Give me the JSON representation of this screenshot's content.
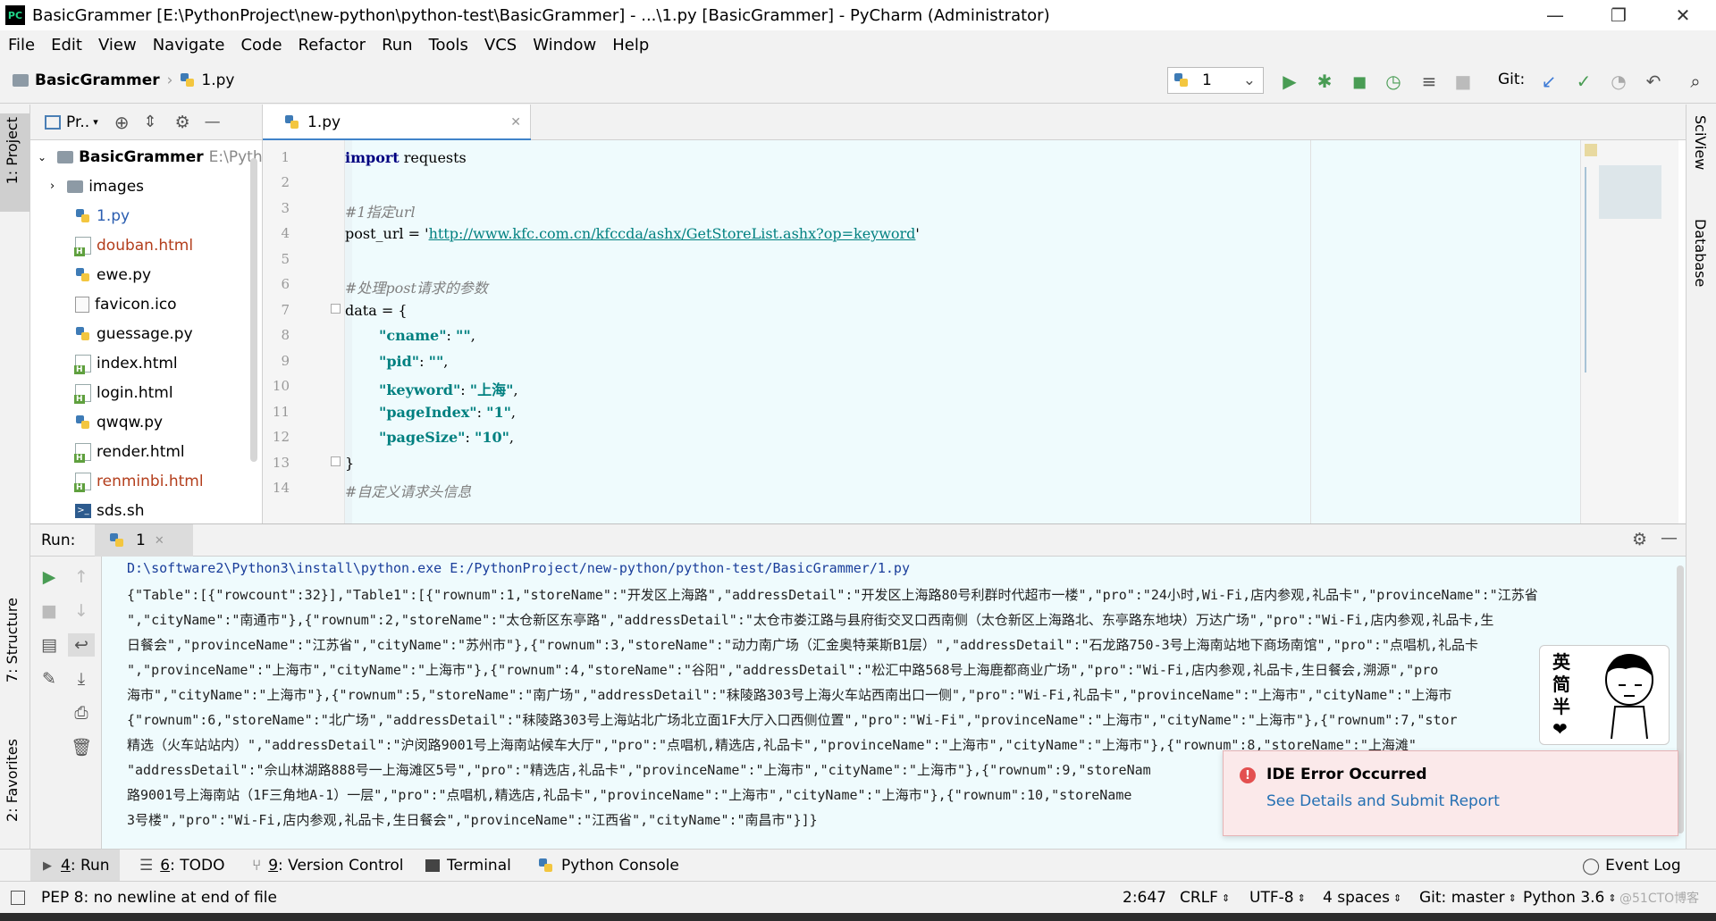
{
  "window": {
    "title": "BasicGrammer [E:\\PythonProject\\new-python\\python-test\\BasicGrammer] - ...\\1.py [BasicGrammer] - PyCharm (Administrator)",
    "app_icon": "PC"
  },
  "menu": [
    "File",
    "Edit",
    "View",
    "Navigate",
    "Code",
    "Refactor",
    "Run",
    "Tools",
    "VCS",
    "Window",
    "Help"
  ],
  "navbar": {
    "project": "BasicGrammer",
    "file": "1.py",
    "run_config": "1",
    "git_label": "Git:"
  },
  "left_stripe": {
    "project_tab": "1: Project",
    "structure_tab": "7: Structure",
    "favorites_tab": "2: Favorites"
  },
  "right_stripe": {
    "sciview_tab": "SciView",
    "database_tab": "Database"
  },
  "project_panel": {
    "header": "Pr..",
    "root": {
      "name": "BasicGrammer",
      "path": "E:\\Pytho"
    },
    "items": [
      {
        "name": "images",
        "type": "folder"
      },
      {
        "name": "1.py",
        "type": "py",
        "color": "#2a5db0"
      },
      {
        "name": "douban.html",
        "type": "html",
        "color": "#b33e1c"
      },
      {
        "name": "ewe.py",
        "type": "py",
        "color": "#000000"
      },
      {
        "name": "favicon.ico",
        "type": "file",
        "color": "#000000"
      },
      {
        "name": "guessage.py",
        "type": "py",
        "color": "#000000"
      },
      {
        "name": "index.html",
        "type": "html",
        "color": "#000000"
      },
      {
        "name": "login.html",
        "type": "html",
        "color": "#000000"
      },
      {
        "name": "qwqw.py",
        "type": "py",
        "color": "#000000"
      },
      {
        "name": "render.html",
        "type": "html",
        "color": "#000000"
      },
      {
        "name": "renminbi.html",
        "type": "html",
        "color": "#b33e1c"
      },
      {
        "name": "sds.sh",
        "type": "sh",
        "color": "#000000"
      }
    ]
  },
  "editor": {
    "tab_label": "1.py",
    "line_numbers": [
      "1",
      "2",
      "3",
      "4",
      "5",
      "6",
      "7",
      "8",
      "9",
      "10",
      "11",
      "12",
      "13",
      "14"
    ],
    "lines": {
      "l1_kw": "import",
      "l1_rest": " requests",
      "l3": "#1指定url",
      "l4_a": "post_url = '",
      "l4_url": "http://www.kfc.com.cn/kfccda/ashx/GetStoreList.ashx?op=keyword",
      "l4_b": "'",
      "l6": "#处理post请求的参数",
      "l7": "data = {",
      "l8_k": "\"cname\"",
      "l8_v": "\"\"",
      "l9_k": "\"pid\"",
      "l9_v": "\"\"",
      "l10_k": "\"keyword\"",
      "l10_v": "\"上海\"",
      "l11_k": "\"pageIndex\"",
      "l11_v": "\"1\"",
      "l12_k": "\"pageSize\"",
      "l12_v": "\"10\"",
      "l13": "}",
      "l14": "#自定义请求头信息"
    }
  },
  "run_panel": {
    "label": "Run:",
    "tab": "1",
    "command": "D:\\software2\\Python3\\install\\python.exe E:/PythonProject/new-python/python-test/BasicGrammer/1.py",
    "output": [
      "{\"Table\":[{\"rowcount\":32}],\"Table1\":[{\"rownum\":1,\"storeName\":\"开发区上海路\",\"addressDetail\":\"开发区上海路80号利群时代超市一楼\",\"pro\":\"24小时,Wi-Fi,店内参观,礼品卡\",\"provinceName\":\"江苏省",
      "\",\"cityName\":\"南通市\"},{\"rownum\":2,\"storeName\":\"太仓新区东亭路\",\"addressDetail\":\"太仓市娄江路与县府街交叉口西南侧（太仓新区上海路北、东亭路东地块）万达广场\",\"pro\":\"Wi-Fi,店内参观,礼品卡,生",
      "日餐会\",\"provinceName\":\"江苏省\",\"cityName\":\"苏州市\"},{\"rownum\":3,\"storeName\":\"动力南广场（汇金奥特莱斯B1层）\",\"addressDetail\":\"石龙路750-3号上海南站地下商场南馆\",\"pro\":\"点唱机,礼品卡",
      "\",\"provinceName\":\"上海市\",\"cityName\":\"上海市\"},{\"rownum\":4,\"storeName\":\"谷阳\",\"addressDetail\":\"松汇中路568号上海鹿都商业广场\",\"pro\":\"Wi-Fi,店内参观,礼品卡,生日餐会,溯源\",\"pro",
      "海市\",\"cityName\":\"上海市\"},{\"rownum\":5,\"storeName\":\"南广场\",\"addressDetail\":\"秣陵路303号上海火车站西南出口一侧\",\"pro\":\"Wi-Fi,礼品卡\",\"provinceName\":\"上海市\",\"cityName\":\"上海市",
      "{\"rownum\":6,\"storeName\":\"北广场\",\"addressDetail\":\"秣陵路303号上海站北广场北立面1F大厅入口西侧位置\",\"pro\":\"Wi-Fi\",\"provinceName\":\"上海市\",\"cityName\":\"上海市\"},{\"rownum\":7,\"stor",
      "精选（火车站站内）\",\"addressDetail\":\"沪闵路9001号上海南站候车大厅\",\"pro\":\"点唱机,精选店,礼品卡\",\"provinceName\":\"上海市\",\"cityName\":\"上海市\"},{\"rownum\":8,\"storeName\":\"上海滩\"",
      "\"addressDetail\":\"佘山林湖路888号一上海滩区5号\",\"pro\":\"精选店,礼品卡\",\"provinceName\":\"上海市\",\"cityName\":\"上海市\"},{\"rownum\":9,\"storeNam",
      "路9001号上海南站（1F三角地A-1）一层\",\"pro\":\"点唱机,精选店,礼品卡\",\"provinceName\":\"上海市\",\"cityName\":\"上海市\"},{\"rownum\":10,\"storeName",
      "3号楼\",\"pro\":\"Wi-Fi,店内参观,礼品卡,生日餐会\",\"provinceName\":\"江西省\",\"cityName\":\"南昌市\"}]}"
    ]
  },
  "error_popup": {
    "title": "IDE Error Occurred",
    "link": "See Details and Submit Report"
  },
  "sticker": {
    "chars": [
      "英",
      "简",
      "半",
      "❤"
    ]
  },
  "bottom_tabs": [
    {
      "num": "4",
      "label": ": Run"
    },
    {
      "num": "6",
      "label": ": TODO"
    },
    {
      "num": "9",
      "label": ": Version Control"
    },
    {
      "num": "",
      "label": "Terminal"
    },
    {
      "num": "",
      "label": "Python Console"
    }
  ],
  "event_log": "Event Log",
  "status": {
    "message": "PEP 8: no newline at end of file",
    "position": "2:647",
    "line_sep": "CRLF",
    "encoding": "UTF-8",
    "indent": "4 spaces",
    "git": "Git: master",
    "interpreter": "Python 3.6",
    "watermark": "@51CTO博客"
  },
  "colors": {
    "accent": "#4083c9",
    "run_green": "#499c54",
    "editor_bg": "#effbfd",
    "error_red": "#e34f4f"
  }
}
